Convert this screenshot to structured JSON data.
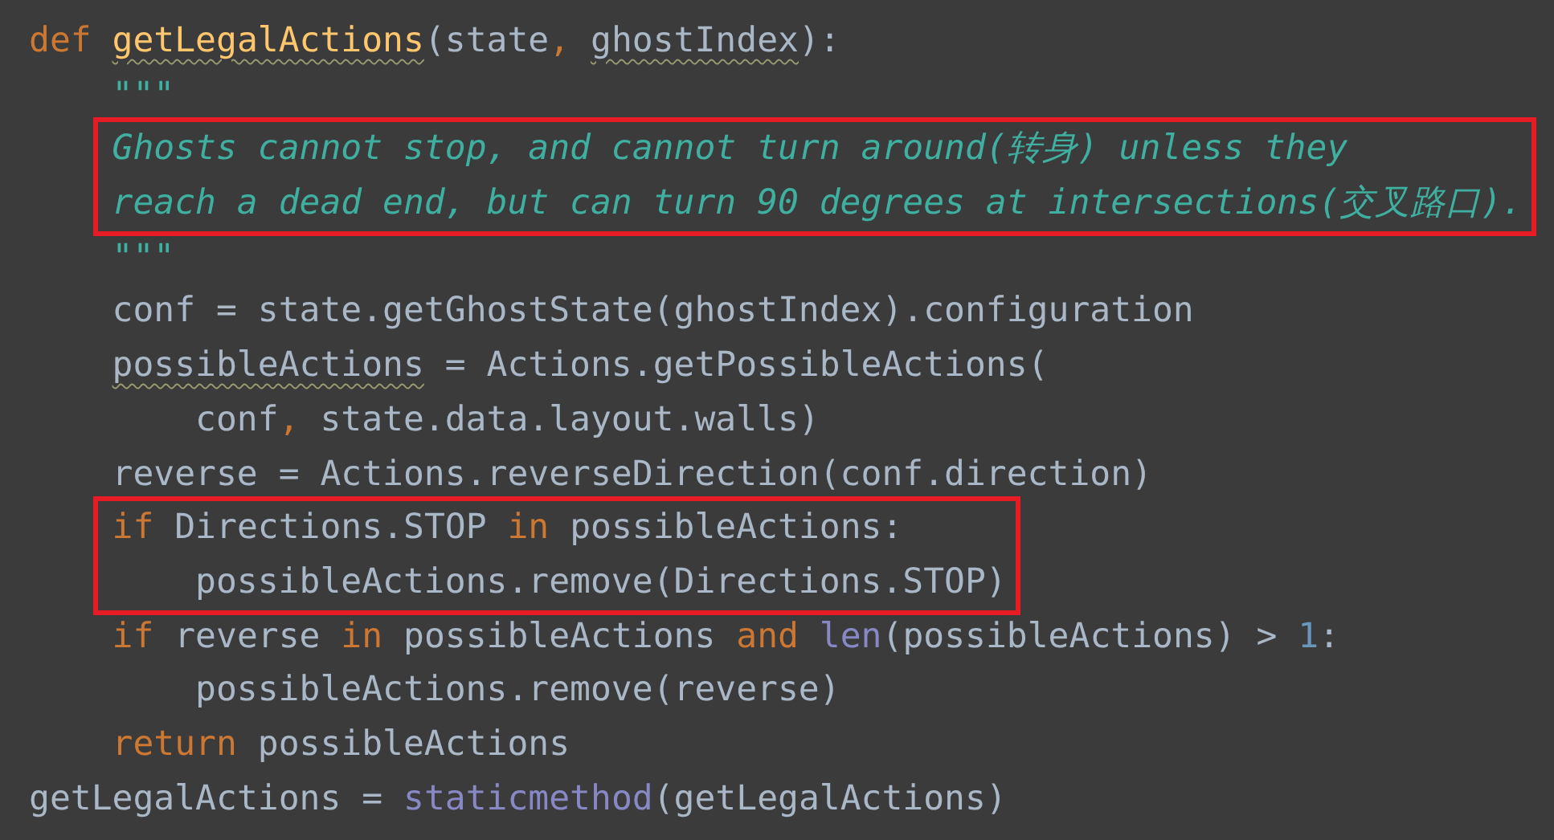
{
  "code": [
    {
      "kind": "line",
      "tokens": [
        {
          "kind": "keyword",
          "text": "def "
        },
        {
          "kind": "function",
          "text": "getLegalActions",
          "spell_warning": true
        },
        {
          "kind": "plain",
          "text": "(state"
        },
        {
          "kind": "keyword",
          "text": ", "
        },
        {
          "kind": "plain",
          "text": "ghostIndex",
          "spell_warning": true
        },
        {
          "kind": "plain",
          "text": "):"
        }
      ],
      "children": [
        {
          "kind": "line",
          "tokens": [
            {
              "kind": "docstring",
              "text": "\"\"\""
            }
          ]
        },
        {
          "kind": "highlight",
          "lines": [
            {
              "kind": "line",
              "tokens": [
                {
                  "kind": "docstring",
                  "text": "Ghosts cannot stop, and cannot turn around(转身) unless they"
                }
              ]
            },
            {
              "kind": "line",
              "tokens": [
                {
                  "kind": "docstring",
                  "text": "reach a dead end, but can turn 90 degrees at intersections(交叉路口)."
                }
              ]
            }
          ]
        },
        {
          "kind": "line",
          "tokens": [
            {
              "kind": "docstring",
              "text": "\"\"\""
            }
          ]
        },
        {
          "kind": "line",
          "tokens": [
            {
              "kind": "plain",
              "text": "conf = state.getGhostState(ghostIndex).configuration"
            }
          ]
        },
        {
          "kind": "line",
          "tokens": [
            {
              "kind": "plain",
              "text": "possibleActions",
              "spell_warning": true
            },
            {
              "kind": "plain",
              "text": " = Actions.getPossibleActions("
            }
          ],
          "children": [
            {
              "kind": "line",
              "tokens": [
                {
                  "kind": "plain",
                  "text": "conf"
                },
                {
                  "kind": "keyword",
                  "text": ", "
                },
                {
                  "kind": "plain",
                  "text": "state.data.layout.walls)"
                }
              ]
            }
          ]
        },
        {
          "kind": "line",
          "tokens": [
            {
              "kind": "plain",
              "text": "reverse = Actions.reverseDirection(conf.direction)"
            }
          ]
        },
        {
          "kind": "highlight",
          "lines": [
            {
              "kind": "line",
              "tokens": [
                {
                  "kind": "keyword",
                  "text": "if "
                },
                {
                  "kind": "plain",
                  "text": "Directions.STOP "
                },
                {
                  "kind": "keyword",
                  "text": "in "
                },
                {
                  "kind": "plain",
                  "text": "possibleActions:"
                }
              ],
              "children": [
                {
                  "kind": "line",
                  "tokens": [
                    {
                      "kind": "plain",
                      "text": "possibleActions.remove(Directions.STOP)"
                    }
                  ]
                }
              ]
            }
          ]
        },
        {
          "kind": "line",
          "tokens": [
            {
              "kind": "keyword",
              "text": "if "
            },
            {
              "kind": "plain",
              "text": "reverse "
            },
            {
              "kind": "keyword",
              "text": "in "
            },
            {
              "kind": "plain",
              "text": "possibleActions "
            },
            {
              "kind": "keyword",
              "text": "and "
            },
            {
              "kind": "builtin",
              "text": "len"
            },
            {
              "kind": "plain",
              "text": "(possibleActions) > "
            },
            {
              "kind": "number",
              "text": "1"
            },
            {
              "kind": "plain",
              "text": ":"
            }
          ],
          "children": [
            {
              "kind": "line",
              "tokens": [
                {
                  "kind": "plain",
                  "text": "possibleActions.remove(reverse)"
                }
              ]
            }
          ]
        },
        {
          "kind": "line",
          "tokens": [
            {
              "kind": "keyword",
              "text": "return "
            },
            {
              "kind": "plain",
              "text": "possibleActions"
            }
          ]
        }
      ]
    },
    {
      "kind": "line",
      "tokens": [
        {
          "kind": "plain",
          "text": "getLegalActions = "
        },
        {
          "kind": "builtin",
          "text": "staticmethod"
        },
        {
          "kind": "plain",
          "text": "(getLegalActions)"
        }
      ]
    }
  ]
}
